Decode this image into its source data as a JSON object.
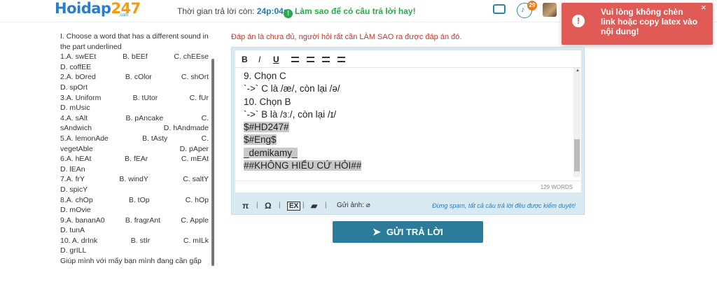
{
  "header": {
    "logo_main": "Hoidap",
    "logo_num": "247",
    "logo_sub": ".com",
    "timer_label": "Thời gian trả lời còn:",
    "timer_value": "24p:04s",
    "howto": "Làm sao để có câu trả lời hay!",
    "notification_count": "29"
  },
  "toast": {
    "message": "Vui lòng không chèn link hoặc copy latex vào nội dung!",
    "close": "×"
  },
  "question": {
    "intro": "I. Choose a word that has a different sound in the part underlined",
    "rows": [
      [
        "1.A. swEEt",
        "B. bEEf",
        "C. chEEse"
      ],
      [
        "D. coffEE"
      ],
      [
        "2.A. bOred",
        "B. cOlor",
        "C. shOrt"
      ],
      [
        "D. spOrt"
      ],
      [
        "3.A. Uniform",
        "B. tUtor",
        "C. fUr"
      ],
      [
        "D. mUsic"
      ],
      [
        "4.A. sAlt",
        "B. pAncake",
        "C."
      ],
      [
        "sAndwich",
        "D. hAndmade"
      ],
      [
        "5.A. lemonAde",
        "B. tAsty",
        "C."
      ],
      [
        "vegetAble",
        "D. pAper"
      ],
      [
        "6.A. hEAt",
        "B. fEAr",
        "C. mEAt"
      ],
      [
        "D. lEAn"
      ],
      [
        "7.A. frY",
        "B. windY",
        "C. saltY"
      ],
      [
        "D. spicY"
      ],
      [
        "8.A. chOp",
        "B. tOp",
        "C. hOp"
      ],
      [
        "D. mOvie"
      ],
      [
        "9.A. bananA0",
        "B. fragrAnt",
        "C. Apple"
      ],
      [
        "D. tunA"
      ],
      [
        "10. A. drInk",
        "B. stIr",
        "C. mILk"
      ],
      [
        "D. grILL"
      ]
    ],
    "closing": "Giúp mình với mấy bạn mình đang cần gấp"
  },
  "answer": {
    "notice": "Đáp án là chưa đủ, người hỏi rất cần LÀM SAO ra được đáp án đó.",
    "lines": [
      {
        "text": "9. Chọn C",
        "hl": false
      },
      {
        "text": "`->` C là /æ/, còn lại /ə/",
        "hl": false
      },
      {
        "text": "10. Chọn B",
        "hl": false
      },
      {
        "text": "`->` B là /ɜː/, còn lại /ɪ/",
        "hl": false
      },
      {
        "text": "$#HD247#",
        "hl": true
      },
      {
        "text": "$#Eng$",
        "hl": true
      },
      {
        "text": "_demikamy_",
        "hl": true
      },
      {
        "text": "##KHÔNG HIỂU CỨ HỎI##",
        "hl": true
      }
    ],
    "word_count": "129 WORDS",
    "upload_label": "Gửi ảnh:",
    "spam_notice": "Đừng spam, tất cả câu trả lời đều được kiểm duyệt!",
    "submit_label": "GỬI TRẢ LỜI"
  },
  "toolbar": {
    "bold": "B",
    "italic": "I",
    "underline": "U",
    "pi": "π",
    "omega": "Ω"
  }
}
